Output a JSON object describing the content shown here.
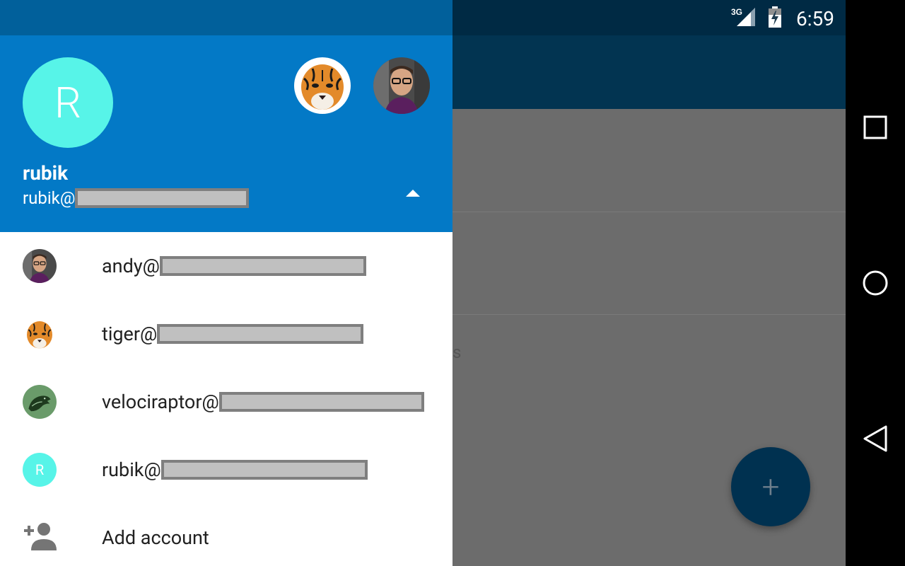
{
  "status_bar": {
    "network": "3G",
    "time": "6:59"
  },
  "drawer": {
    "header": {
      "avatar_letter": "R",
      "name": "rubik",
      "email_prefix": "rubik@"
    },
    "accounts": [
      {
        "email_prefix": "andy@",
        "avatar": "person-photo"
      },
      {
        "email_prefix": "tiger@",
        "avatar": "tiger-photo"
      },
      {
        "email_prefix": "velociraptor@",
        "avatar": "velociraptor-photo"
      },
      {
        "email_prefix": "rubik@",
        "avatar": "letter-R",
        "letter": "R"
      }
    ],
    "add_account_label": "Add account"
  },
  "background": {
    "partial_text": "s",
    "fab_symbol": "+"
  },
  "colors": {
    "header_blue": "#0379c6",
    "drawer_status": "#01609b",
    "avatar_teal": "#57f4e8",
    "fab": "#003150"
  },
  "icons": {
    "nav": [
      "recents-icon",
      "home-icon",
      "back-icon"
    ],
    "status": [
      "signal-icon",
      "battery-icon"
    ]
  }
}
